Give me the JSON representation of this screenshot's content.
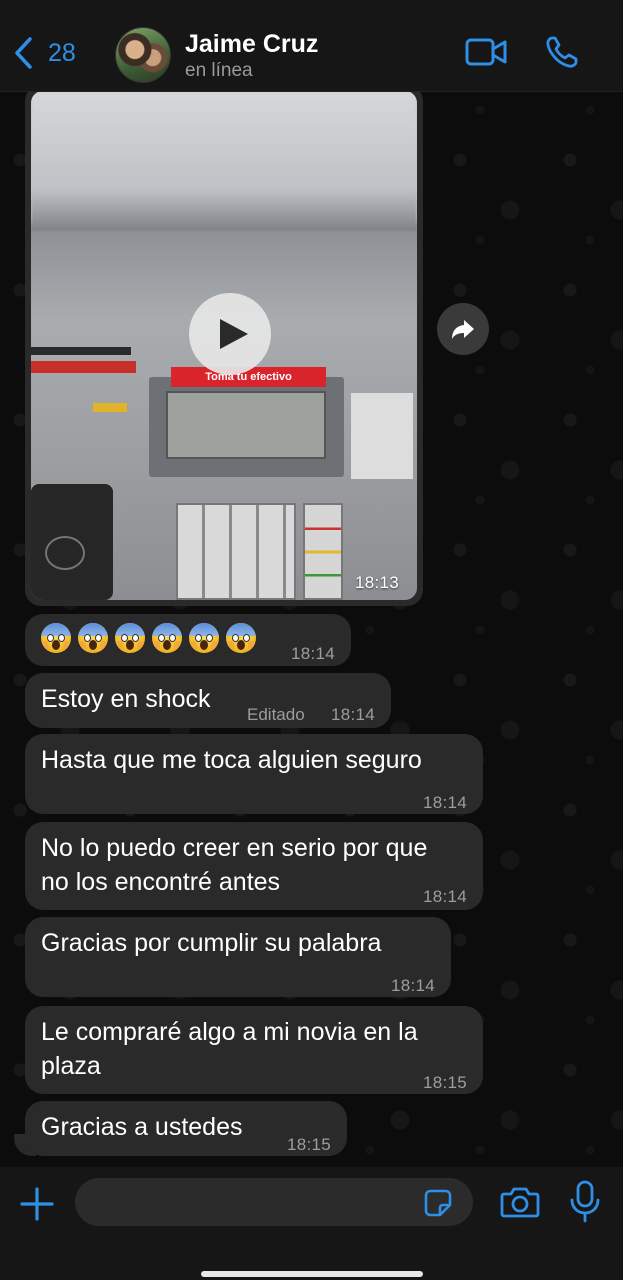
{
  "header": {
    "back_count": "28",
    "contact_name": "Jaime Cruz",
    "contact_status": "en línea",
    "icons": [
      "chevron-left-icon",
      "video-call-icon",
      "phone-icon"
    ]
  },
  "video_message": {
    "time": "18:13",
    "atm_label": "Toma tu efectivo",
    "icons": [
      "play-icon",
      "forward-icon"
    ]
  },
  "messages": [
    {
      "type": "emoji",
      "emoji": [
        "😱",
        "😱",
        "😱",
        "😱",
        "😱",
        "😱"
      ],
      "time": "18:14"
    },
    {
      "type": "text",
      "text": "Estoy en shock",
      "edited": "Editado",
      "time": "18:14"
    },
    {
      "type": "text",
      "text": "Hasta que me toca alguien seguro",
      "time": "18:14"
    },
    {
      "type": "text",
      "text_line1": "No lo puedo creer en serio por que",
      "text_line2": "no los encontré antes",
      "time": "18:14"
    },
    {
      "type": "text",
      "text": "Gracias por cumplir su palabra",
      "time": "18:14"
    },
    {
      "type": "text",
      "text_line1": "Le compraré algo a mi novia en la",
      "text_line2": "plaza",
      "time": "18:15"
    },
    {
      "type": "text",
      "text": "Gracias a ustedes",
      "time": "18:15"
    }
  ],
  "composer": {
    "input_value": "",
    "icons": [
      "plus-icon",
      "sticker-icon",
      "camera-icon",
      "microphone-icon"
    ]
  },
  "colors": {
    "accent": "#2e8fe6",
    "bubble": "#2a2a2a",
    "background": "#0c0c0c",
    "header": "#161616"
  }
}
